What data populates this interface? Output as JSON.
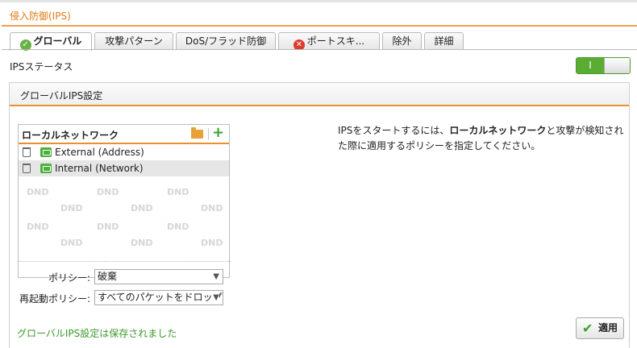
{
  "page": {
    "title": "侵入防御(IPS)"
  },
  "tabs": [
    {
      "label": "グローバル",
      "icon": "check-icon"
    },
    {
      "label": "攻撃パターン"
    },
    {
      "label": "DoS/フラッド防御"
    },
    {
      "label": "ポートスキ...",
      "icon": "error-icon"
    },
    {
      "label": "除外"
    },
    {
      "label": "詳細"
    }
  ],
  "status": {
    "label": "IPSステータス",
    "toggle_text": "I",
    "enabled": true
  },
  "panel": {
    "title": "グローバルIPS設定",
    "network_list": {
      "title": "ローカルネットワーク",
      "items": [
        {
          "label": "External (Address)"
        },
        {
          "label": "Internal (Network)"
        }
      ],
      "dnd_text": "DND"
    },
    "info": {
      "part1": "IPSをスタートするには、",
      "bold": "ローカルネットワーク",
      "part2": "と攻撃が検知された際に適用するポリシーを指定してください。"
    },
    "policy": {
      "label": "ポリシー:",
      "value": "破棄"
    },
    "restart_policy": {
      "label": "再起動ポリシー:",
      "value": "すべてのパケットをドロップ"
    },
    "saved_message": "グローバルIPS設定は保存されました",
    "apply_label": "適用"
  },
  "colors": {
    "accent": "#e8922e",
    "title": "#e07b14",
    "green": "#5aac32",
    "error": "#dd3b2c"
  }
}
